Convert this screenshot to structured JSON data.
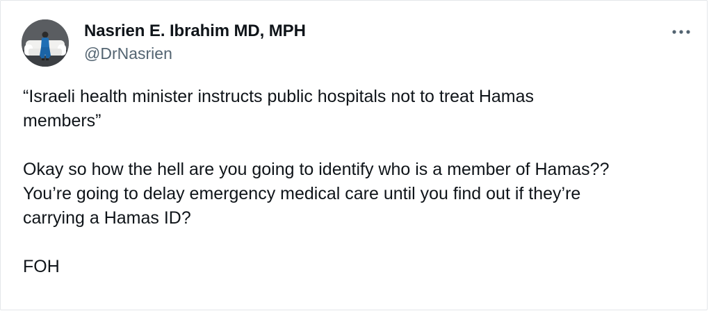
{
  "author": {
    "display_name": "Nasrien E. Ibrahim MD, MPH",
    "handle": "@DrNasrien",
    "avatar_icon": "profile-photo-icon"
  },
  "more_icon": "ellipsis-icon",
  "tweet": {
    "paragraphs": [
      "“Israeli health minister instructs public hospitals not to treat Hamas\nmembers”",
      "Okay so how the hell are you going to identify who is a member of Hamas??\nYou’re going to delay emergency medical care until you find out if they’re\ncarrying a Hamas ID?",
      "FOH"
    ]
  },
  "colors": {
    "text": "#0f1419",
    "secondary_text": "#536471",
    "border": "#e3e6e9"
  }
}
